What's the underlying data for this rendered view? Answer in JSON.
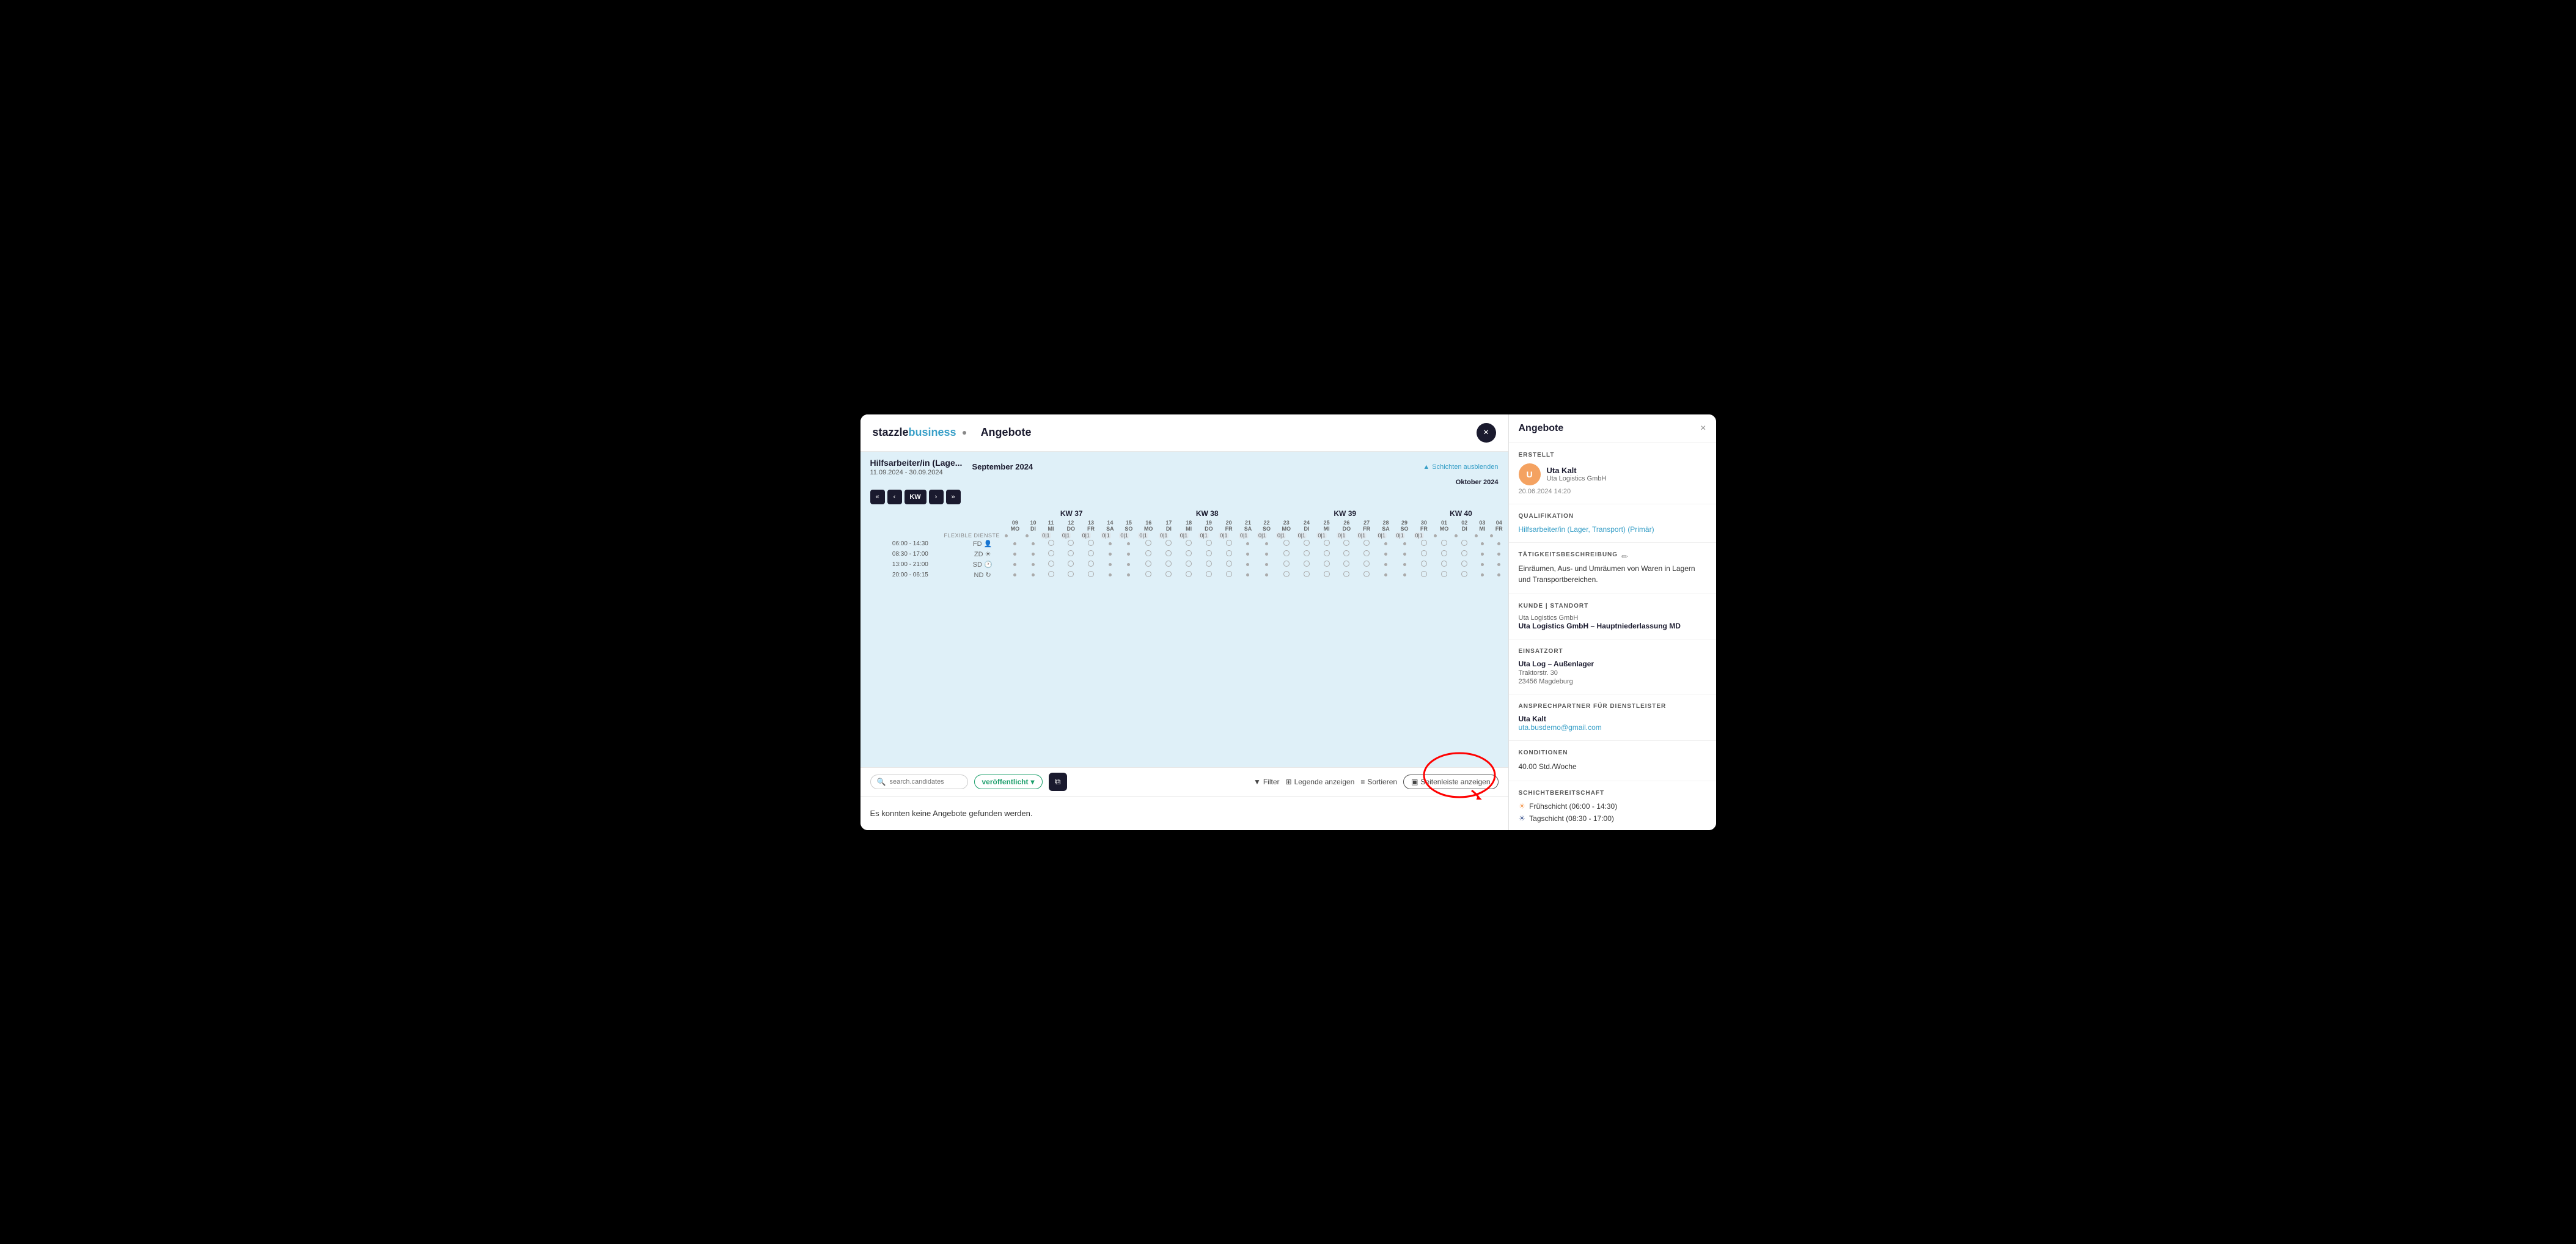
{
  "app": {
    "logo_stazzle": "stazzle",
    "logo_business": "business",
    "page_title": "Angebote",
    "close_btn_label": "×"
  },
  "calendar": {
    "job_title": "Hilfsarbeiter/in (Lage...",
    "month_label": "September 2024",
    "date_range": "11.09.2024 - 30.09.2024",
    "hide_shifts_label": "Schichten ausblenden",
    "next_month_label": "Oktober 2024",
    "nav_buttons": [
      "«",
      "‹",
      "KW",
      "›",
      "»"
    ],
    "kw_groups": [
      {
        "label": "KW 37",
        "span": 7
      },
      {
        "label": "KW 38",
        "span": 7
      },
      {
        "label": "KW 39",
        "span": 7
      },
      {
        "label": "KW 40",
        "span": 6
      }
    ],
    "days": [
      {
        "num": "09",
        "day": "MO"
      },
      {
        "num": "10",
        "day": "DI"
      },
      {
        "num": "11",
        "day": "MI"
      },
      {
        "num": "12",
        "day": "DO"
      },
      {
        "num": "13",
        "day": "FR"
      },
      {
        "num": "14",
        "day": "SA"
      },
      {
        "num": "15",
        "day": "SO"
      },
      {
        "num": "16",
        "day": "MO"
      },
      {
        "num": "17",
        "day": "DI"
      },
      {
        "num": "18",
        "day": "MI"
      },
      {
        "num": "19",
        "day": "DO"
      },
      {
        "num": "20",
        "day": "FR"
      },
      {
        "num": "21",
        "day": "SA"
      },
      {
        "num": "22",
        "day": "SO"
      },
      {
        "num": "23",
        "day": "MO"
      },
      {
        "num": "24",
        "day": "DI"
      },
      {
        "num": "25",
        "day": "MI"
      },
      {
        "num": "26",
        "day": "DO"
      },
      {
        "num": "27",
        "day": "FR"
      },
      {
        "num": "28",
        "day": "SA"
      },
      {
        "num": "29",
        "day": "SO"
      },
      {
        "num": "30",
        "day": "FR"
      },
      {
        "num": "01",
        "day": "MO"
      },
      {
        "num": "02",
        "day": "DI"
      },
      {
        "num": "03",
        "day": "MI"
      },
      {
        "num": "04",
        "day": "FR"
      }
    ],
    "flexible_label": "FLEXIBLE DIENSTE",
    "shifts": [
      {
        "time": "06:00 - 14:30",
        "code": "FD",
        "icon": "👤"
      },
      {
        "time": "08:30 - 17:00",
        "code": "ZD",
        "icon": "☀"
      },
      {
        "time": "13:00 - 21:00",
        "code": "SD",
        "icon": "🕐"
      },
      {
        "time": "20:00 - 06:15",
        "code": "ND",
        "icon": "↻"
      }
    ]
  },
  "toolbar": {
    "search_placeholder": "search.candidates",
    "status_label": "veröffentlicht",
    "filter_label": "Filter",
    "legend_label": "Legende anzeigen",
    "sort_label": "Sortieren",
    "sidebar_label": "Seitenleiste anzeigen"
  },
  "no_offers_message": "Es konnten keine Angebote gefunden werden.",
  "sidebar": {
    "title": "Angebote",
    "close_label": "×",
    "sections": {
      "erstellt_label": "ERSTELLT",
      "creator_name": "Uta Kalt",
      "creator_company": "Uta Logistics GmbH",
      "creator_date": "20.06.2024 14:20",
      "qualifikation_label": "QUALIFIKATION",
      "qualifikation_value": "Hilfsarbeiter/in (Lager, Transport) (Primär)",
      "taetigkeitsbeschreibung_label": "TÄTIGKEITSBESCHREIBUNG",
      "taetigkeitsbeschreibung_value": "Einräumen, Aus- und Umräumen von Waren in Lagern und Transportbereichen.",
      "kunde_standort_label": "KUNDE | STANDORT",
      "kunde_name": "Uta Logistics GmbH",
      "standort_name": "Uta Logistics GmbH – Hauptniederlassung MD",
      "einsatzort_label": "EINSATZORT",
      "einsatzort_name": "Uta Log – Außenlager",
      "einsatzort_street": "Traktorstr. 30",
      "einsatzort_city": "23456 Magdeburg",
      "ansprechpartner_label": "ANSPRECHPARTNER FÜR DIENSTLEISTER",
      "ansprechpartner_name": "Uta Kalt",
      "ansprechpartner_email": "uta.busdemo@gmail.com",
      "konditionen_label": "KONDITIONEN",
      "konditionen_value": "40.00 Std./Woche",
      "schichtbereitschaft_label": "SCHICHTBEREITSCHAFT",
      "schicht_frueh": "Frühschicht (06:00 - 14:30)",
      "schicht_tag": "Tagschicht (08:30 - 17:00)"
    }
  }
}
